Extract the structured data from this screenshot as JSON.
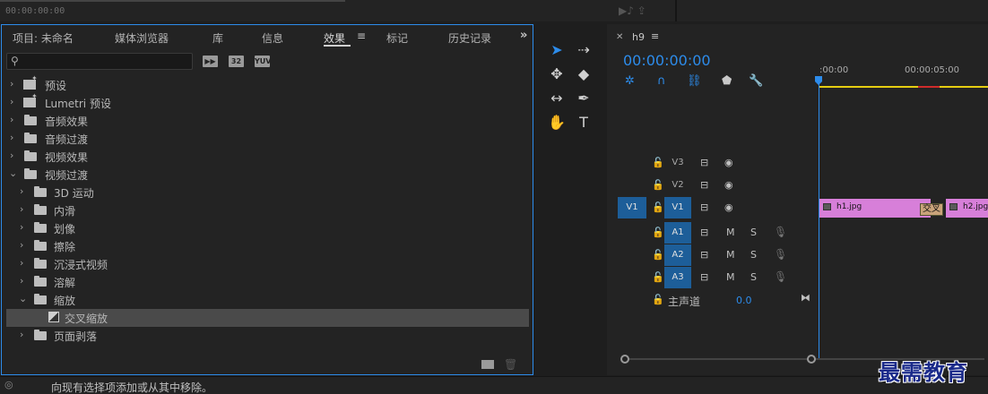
{
  "top": {
    "timecode": "00:00:00:00"
  },
  "effects_panel": {
    "tabs": [
      {
        "label": "项目: 未命名",
        "active": false
      },
      {
        "label": "媒体浏览器",
        "active": false
      },
      {
        "label": "库",
        "active": false
      },
      {
        "label": "信息",
        "active": false
      },
      {
        "label": "效果",
        "active": true
      },
      {
        "label": "标记",
        "active": false
      },
      {
        "label": "历史记录",
        "active": false
      }
    ],
    "menu_icon": "≡",
    "overflow_icon": "»",
    "search": {
      "value": "",
      "placeholder": ""
    },
    "badges": [
      "▶▶",
      "32",
      "YUV"
    ],
    "items": [
      {
        "label": "预设",
        "level": 0,
        "expanded": false,
        "icon": "preset-folder-icon"
      },
      {
        "label": "Lumetri 预设",
        "level": 0,
        "expanded": false,
        "icon": "preset-folder-icon"
      },
      {
        "label": "音频效果",
        "level": 0,
        "expanded": false,
        "icon": "folder-icon"
      },
      {
        "label": "音频过渡",
        "level": 0,
        "expanded": false,
        "icon": "folder-icon"
      },
      {
        "label": "视频效果",
        "level": 0,
        "expanded": false,
        "icon": "folder-icon"
      },
      {
        "label": "视频过渡",
        "level": 0,
        "expanded": true,
        "icon": "folder-icon"
      },
      {
        "label": "3D 运动",
        "level": 1,
        "expanded": false,
        "icon": "folder-icon"
      },
      {
        "label": "内滑",
        "level": 1,
        "expanded": false,
        "icon": "folder-icon"
      },
      {
        "label": "划像",
        "level": 1,
        "expanded": false,
        "icon": "folder-icon"
      },
      {
        "label": "擦除",
        "level": 1,
        "expanded": false,
        "icon": "folder-icon"
      },
      {
        "label": "沉浸式视频",
        "level": 1,
        "expanded": false,
        "icon": "folder-icon"
      },
      {
        "label": "溶解",
        "level": 1,
        "expanded": false,
        "icon": "folder-icon"
      },
      {
        "label": "缩放",
        "level": 1,
        "expanded": true,
        "icon": "folder-icon"
      },
      {
        "label": "交叉缩放",
        "level": 2,
        "selected": true,
        "icon": "transition-icon"
      },
      {
        "label": "页面剥落",
        "level": 1,
        "expanded": false,
        "icon": "folder-icon"
      }
    ]
  },
  "timeline": {
    "sequence_name": "h9",
    "timecode": "00:00:00:00",
    "ruler_labels": [
      ":00:00",
      "00:00:05:00"
    ],
    "tracks": [
      {
        "name": "V3",
        "targeted": false,
        "source": ""
      },
      {
        "name": "V2",
        "targeted": false,
        "source": ""
      },
      {
        "name": "V1",
        "targeted": true,
        "source": "V1"
      },
      {
        "name": "A1",
        "targeted": true,
        "source": ""
      },
      {
        "name": "A2",
        "targeted": true,
        "source": ""
      },
      {
        "name": "A3",
        "targeted": true,
        "source": ""
      }
    ],
    "audio_buttons": {
      "mute": "M",
      "solo": "S"
    },
    "clips": [
      {
        "label": "h1.jpg"
      },
      {
        "label": "h2.jpg"
      }
    ],
    "transition_label": "交叉",
    "master": {
      "label": "主声道",
      "value": "0.0"
    }
  },
  "status_bar": {
    "text": "向现有选择项添加或从其中移除。"
  },
  "watermark": "最需教育",
  "colors": {
    "accent": "#2d8ceb",
    "clip": "#d77fd9",
    "track_target": "#1d5e99",
    "work_area": "#e5cd11"
  }
}
